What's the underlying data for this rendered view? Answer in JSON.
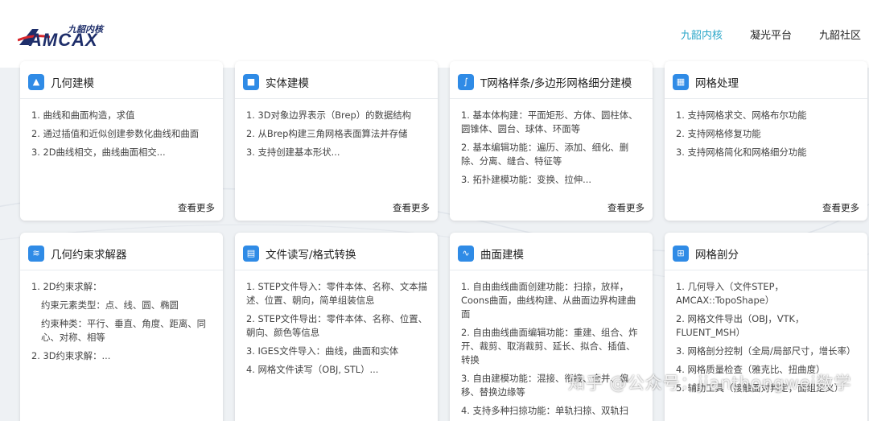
{
  "header": {
    "logo": {
      "tag": "九韶内核",
      "word": "AMCAX"
    },
    "nav": [
      {
        "label": "九韶内核",
        "active": true
      },
      {
        "label": "凝光平台",
        "active": false
      },
      {
        "label": "九韶社区",
        "active": false
      }
    ]
  },
  "cards": [
    {
      "title": "几何建模",
      "icon": "shapes-icon",
      "items": [
        "1. 曲线和曲面构造，求值",
        "2. 通过插值和近似创建参数化曲线和曲面",
        "3. 2D曲线相交，曲线曲面相交..."
      ],
      "more": "查看更多"
    },
    {
      "title": "实体建模",
      "icon": "cube-icon",
      "items": [
        "1. 3D对象边界表示（Brep）的数据结构",
        "2. 从Brep构建三角网格表面算法并存储",
        "3. 支持创建基本形状..."
      ],
      "more": "查看更多"
    },
    {
      "title": "T网格样条/多边形网格细分建模",
      "icon": "spline-icon",
      "items": [
        "1. 基本体构建：平面矩形、方体、圆柱体、圆锥体、圆台、球体、环面等",
        "2. 基本编辑功能：遍历、添加、细化、删除、分离、缝合、特征等",
        "3. 拓扑建模功能：变换、拉伸..."
      ],
      "more": "查看更多"
    },
    {
      "title": "网格处理",
      "icon": "grid-icon",
      "items": [
        "1. 支持网格求交、网格布尔功能",
        "2. 支持网格修复功能",
        "3. 支持网格简化和网格细分功能"
      ],
      "more": "查看更多"
    },
    {
      "title": "几何约束求解器",
      "icon": "constraint-icon",
      "items": [
        "1. 2D约束求解：",
        "约束元素类型：点、线、圆、椭圆",
        "约束种类：平行、垂直、角度、距离、同心、对称、相等",
        "2. 3D约束求解：..."
      ],
      "more": ""
    },
    {
      "title": "文件读写/格式转换",
      "icon": "file-icon",
      "items": [
        "1. STEP文件导入：零件本体、名称、文本描述、位置、朝向，简单组装信息",
        "2. STEP文件导出：零件本体、名称、位置、朝向、颜色等信息",
        "3. IGES文件导入：曲线，曲面和实体",
        "4. 网格文件读写（OBJ, STL）..."
      ],
      "more": ""
    },
    {
      "title": "曲面建模",
      "icon": "surface-icon",
      "items": [
        "1. 自由曲线曲面创建功能：扫掠，放样，Coons曲面，曲线构建、从曲面边界构建曲面",
        "2. 自由曲线曲面编辑功能：重建、组合、炸开、裁剪、取消裁剪、延长、拟合、插值、转换",
        "3. 自由建模功能：混接、衔接、合并、偏移、替换边缘等",
        "4. 支持多种扫掠功能：单轨扫掠、双轨扫"
      ],
      "more": ""
    },
    {
      "title": "网格剖分",
      "icon": "mesh-icon",
      "items": [
        "1. 几何导入（文件STEP，AMCAX::TopoShape）",
        "2. 网格文件导出（OBJ，VTK，FLUENT_MSH）",
        "3. 网格剖分控制（全局/局部尺寸，增长率）",
        "4. 网格质量检查（雅克比、扭曲度）",
        "5. 辅助工具（接触面对判定，面组定义）"
      ],
      "more": ""
    }
  ],
  "watermark": "知乎 @公众号：jianthongwei数学"
}
